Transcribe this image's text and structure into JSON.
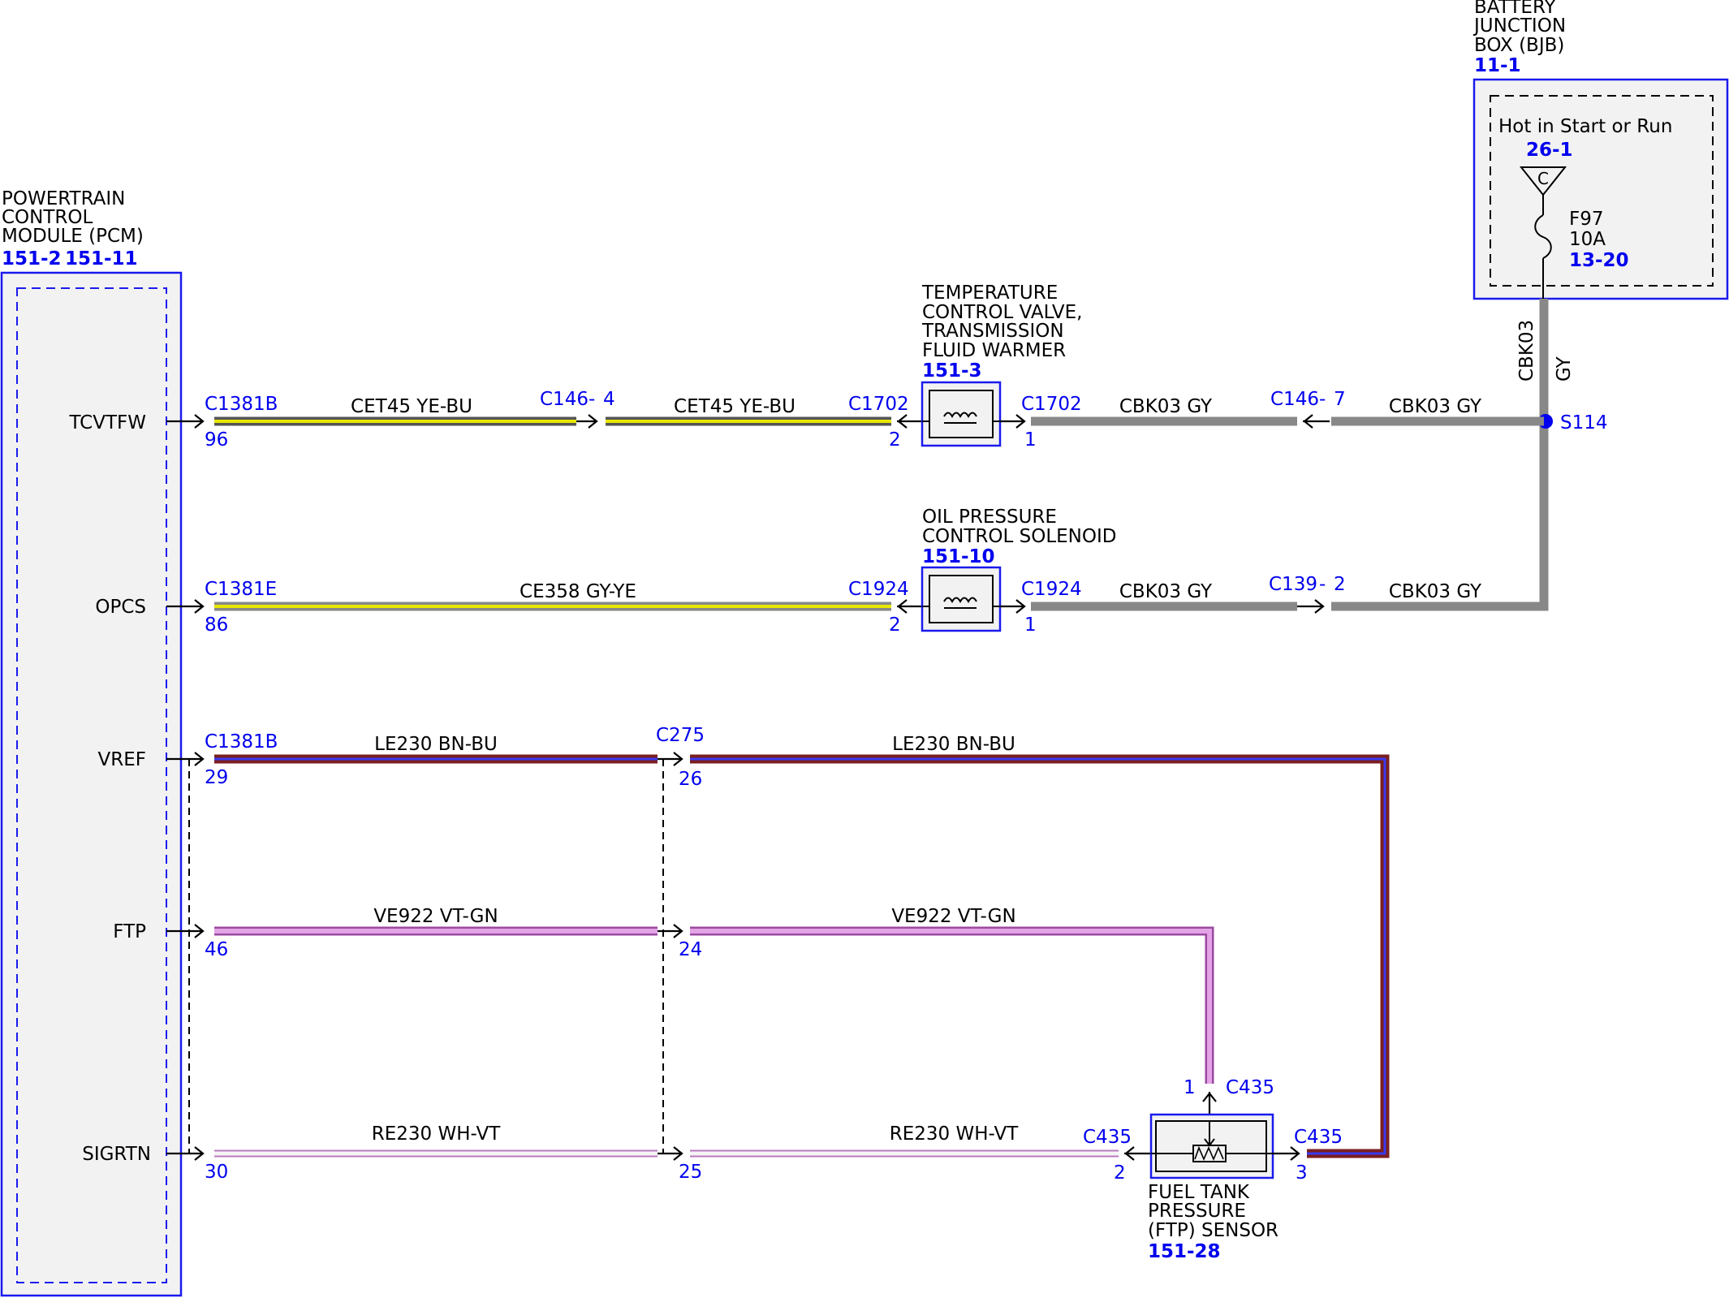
{
  "colors": {
    "outline": "#1a1aee",
    "module_fill": "#f2f2f2",
    "gray_wire": "#888888",
    "yellow_stripe": "#e8e800",
    "brown_wire": "#7a1f1f",
    "blue_stripe": "#3a3af0",
    "violet_wire": "#e3a3e6",
    "white_wire": "#f4f4f4"
  },
  "pcm": {
    "title_lines": [
      "POWERTRAIN",
      "CONTROL",
      "MODULE (PCM)"
    ],
    "refs": [
      "151-2",
      "151-11"
    ],
    "pins": [
      "TCVTFW",
      "OPCS",
      "VREF",
      "FTP",
      "SIGRTN"
    ]
  },
  "bjb": {
    "title_lines": [
      "BATTERY",
      "JUNCTION",
      "BOX (BJB)"
    ],
    "ref": "11-1",
    "hot_label": "Hot in Start or Run",
    "hot_ref": "26-1",
    "terminal": "C",
    "fuse_name": "F97",
    "fuse_rating": "10A",
    "fuse_ref": "13-20",
    "wire_code": "CBK03",
    "wire_color": "GY",
    "splice": "S114"
  },
  "tcv": {
    "title_lines": [
      "TEMPERATURE",
      "CONTROL VALVE,",
      "TRANSMISSION",
      "FLUID WARMER"
    ],
    "ref": "151-3",
    "pcm_connector": "C1381B",
    "pcm_pin": "96",
    "wire1": "CET45  YE-BU",
    "inline": "C146",
    "inline_pin": "4",
    "wire2": "CET45  YE-BU",
    "conn_left": "C1702",
    "pin_left": "2",
    "conn_right": "C1702",
    "pin_right": "1",
    "wire3": "CBK03  GY",
    "inline2": "C146",
    "inline2_pin": "7",
    "wire4": "CBK03  GY"
  },
  "opcs": {
    "title_lines": [
      "OIL PRESSURE",
      "CONTROL SOLENOID"
    ],
    "ref": "151-10",
    "pcm_connector": "C1381E",
    "pcm_pin": "86",
    "wire1": "CE358  GY-YE",
    "conn_left": "C1924",
    "pin_left": "2",
    "conn_right": "C1924",
    "pin_right": "1",
    "wire2": "CBK03  GY",
    "inline": "C139",
    "inline_pin": "2",
    "wire3": "CBK03  GY"
  },
  "vref": {
    "pcm_connector": "C1381B",
    "pcm_pin": "29",
    "wire1": "LE230  BN-BU",
    "inline": "C275",
    "inline_pin": "26",
    "wire2": "LE230  BN-BU"
  },
  "ftp": {
    "pcm_pin": "46",
    "wire1": "VE922  VT-GN",
    "inline_pin": "24",
    "wire2": "VE922  VT-GN"
  },
  "sigrtn": {
    "pcm_pin": "30",
    "wire1": "RE230  WH-VT",
    "inline_pin": "25",
    "wire2": "RE230  WH-VT"
  },
  "ftp_sensor": {
    "title_lines": [
      "FUEL TANK",
      "PRESSURE",
      "(FTP) SENSOR"
    ],
    "ref": "151-28",
    "conn_top": "C435",
    "pin_top": "1",
    "conn_left": "C435",
    "pin_left": "2",
    "conn_right": "C435",
    "pin_right": "3"
  }
}
